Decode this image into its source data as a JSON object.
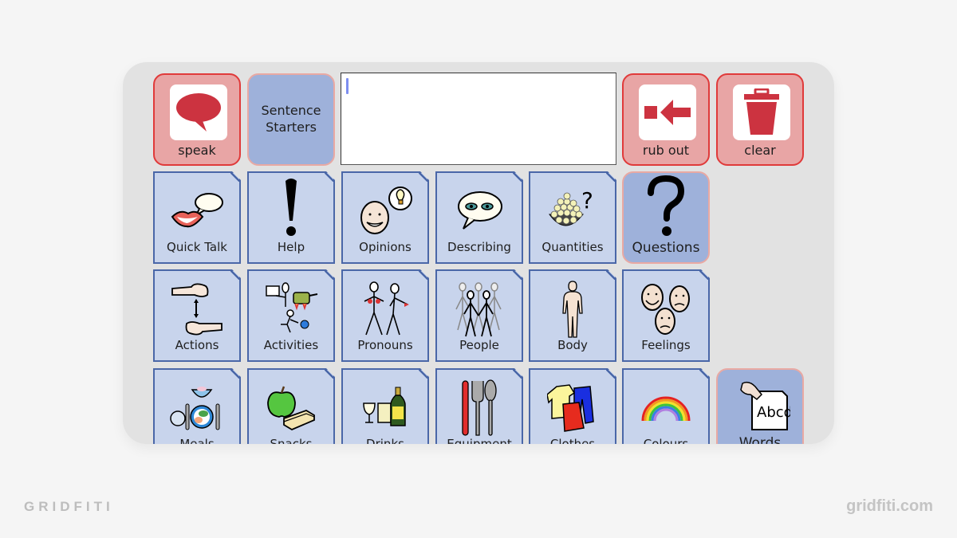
{
  "toolbar": {
    "speak_label": "speak",
    "sentence_starters_label": "Sentence Starters",
    "message_box_value": "",
    "rub_out_label": "rub out",
    "clear_label": "clear"
  },
  "folders": {
    "row1": [
      {
        "label": "Quick Talk",
        "icon": "lips-speech-bubble-icon"
      },
      {
        "label": "Help",
        "icon": "exclamation-icon"
      },
      {
        "label": "Opinions",
        "icon": "thinking-face-lightbulb-icon"
      },
      {
        "label": "Describing",
        "icon": "eyes-speech-bubble-icon"
      },
      {
        "label": "Quantities",
        "icon": "bowl-of-balls-question-icon"
      }
    ],
    "questions_label": "Questions",
    "row2": [
      {
        "label": "Actions",
        "icon": "hands-icon"
      },
      {
        "label": "Activities",
        "icon": "activities-icon"
      },
      {
        "label": "Pronouns",
        "icon": "two-people-pointing-icon"
      },
      {
        "label": "People",
        "icon": "group-of-people-icon"
      },
      {
        "label": "Body",
        "icon": "human-body-icon"
      },
      {
        "label": "Feelings",
        "icon": "faces-icon"
      }
    ],
    "row3": [
      {
        "label": "Meals",
        "icon": "plate-cutlery-icon"
      },
      {
        "label": "Snacks",
        "icon": "apple-sandwich-icon"
      },
      {
        "label": "Drinks",
        "icon": "glasses-bottle-icon"
      },
      {
        "label": "Equipment",
        "icon": "knife-fork-spoon-icon"
      },
      {
        "label": "Clothes",
        "icon": "clothes-icon"
      },
      {
        "label": "Colours",
        "icon": "rainbow-icon"
      }
    ],
    "words_label": "Words",
    "words_card_text": "Abcd"
  },
  "watermark": {
    "brand": "GRIDFITI",
    "url": "gridfiti.com"
  }
}
